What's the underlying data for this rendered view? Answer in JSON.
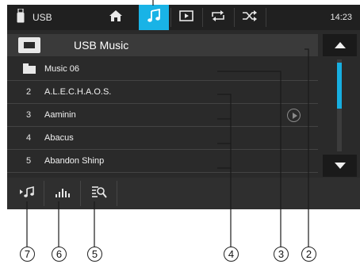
{
  "top_bar": {
    "source_label": "USB",
    "clock": "14:23",
    "buttons": [
      {
        "name": "home",
        "icon": "home-icon"
      },
      {
        "name": "music",
        "icon": "music-note-icon",
        "active": true
      },
      {
        "name": "video",
        "icon": "video-play-icon"
      },
      {
        "name": "repeat",
        "icon": "repeat-icon"
      },
      {
        "name": "shuffle",
        "icon": "shuffle-icon"
      }
    ]
  },
  "header": {
    "title": "USB Music"
  },
  "list": {
    "folder": {
      "name": "Music 06"
    },
    "items": [
      {
        "num": "2",
        "name": "A.L.E.C.H.A.O.S."
      },
      {
        "num": "3",
        "name": "Aaminin"
      },
      {
        "num": "4",
        "name": "Abacus"
      },
      {
        "num": "5",
        "name": "Abandon Shinp"
      }
    ]
  },
  "bottom_bar": {
    "buttons": [
      {
        "name": "now-playing",
        "icon": "now-playing-icon"
      },
      {
        "name": "equalizer",
        "icon": "equalizer-icon"
      },
      {
        "name": "search",
        "icon": "search-list-icon"
      }
    ]
  },
  "callouts": [
    "7",
    "6",
    "5",
    "4",
    "3",
    "2"
  ],
  "colors": {
    "accent": "#19b3e6",
    "background": "#2a2a2a",
    "topbar": "#202020",
    "text": "#f2f2f2"
  }
}
